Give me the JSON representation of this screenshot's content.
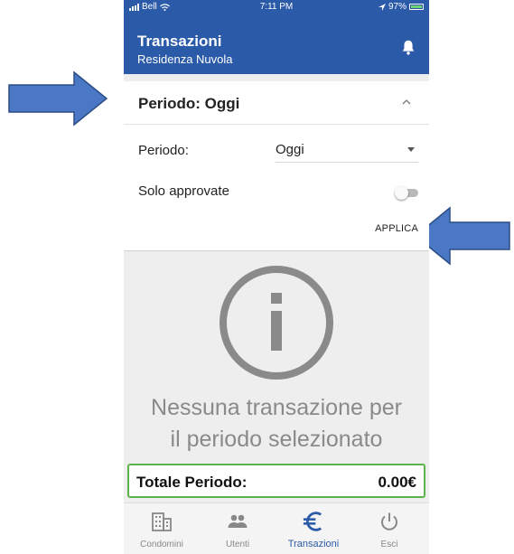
{
  "status_bar": {
    "carrier": "Bell",
    "time": "7:11 PM",
    "battery": "97%"
  },
  "header": {
    "title": "Transazioni",
    "subtitle": "Residenza Nuvola"
  },
  "filter_card": {
    "title": "Periodo: Oggi",
    "period_label": "Periodo:",
    "period_value": "Oggi",
    "approved_label": "Solo approvate",
    "approved_enabled": false,
    "apply_label": "APPLICA"
  },
  "empty_state": {
    "line1": "Nessuna transazione per",
    "line2": "il periodo selezionato"
  },
  "total": {
    "label": "Totale Periodo:",
    "value": "0.00€"
  },
  "bottom_nav": [
    {
      "label": "Condomini",
      "icon": "building-icon",
      "active": false
    },
    {
      "label": "Utenti",
      "icon": "users-icon",
      "active": false
    },
    {
      "label": "Transazioni",
      "icon": "euro-icon",
      "active": true
    },
    {
      "label": "Esci",
      "icon": "power-icon",
      "active": false
    }
  ],
  "colors": {
    "primary": "#2a5aa8",
    "accent_total_border": "#5bb34a",
    "annotation_arrow": "#4a78c4"
  }
}
